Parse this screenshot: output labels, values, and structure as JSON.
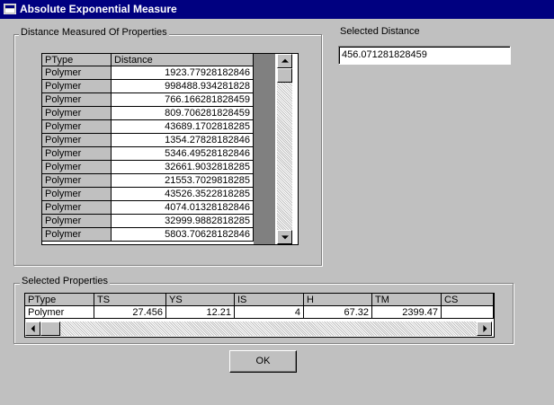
{
  "window": {
    "title": "Absolute Exponential Measure"
  },
  "distance_group": {
    "label": "Distance Measured Of Properties",
    "columns": [
      "PType",
      "Distance"
    ],
    "rows": [
      [
        "Polymer",
        "1923.77928182846"
      ],
      [
        "Polymer",
        "998488.934281828"
      ],
      [
        "Polymer",
        "766.166281828459"
      ],
      [
        "Polymer",
        "809.706281828459"
      ],
      [
        "Polymer",
        "43689.1702818285"
      ],
      [
        "Polymer",
        "1354.27828182846"
      ],
      [
        "Polymer",
        "5346.49528182846"
      ],
      [
        "Polymer",
        "32661.9032818285"
      ],
      [
        "Polymer",
        "21553.7029818285"
      ],
      [
        "Polymer",
        "43526.3522818285"
      ],
      [
        "Polymer",
        "4074.01328182846"
      ],
      [
        "Polymer",
        "32999.9882818285"
      ],
      [
        "Polymer",
        "5803.70628182846"
      ]
    ]
  },
  "selected_distance": {
    "label": "Selected Distance",
    "value": "456.071281828459"
  },
  "properties_group": {
    "label": "Selected Properties",
    "columns": [
      "PType",
      "TS",
      "YS",
      "IS",
      "H",
      "TM",
      "CS"
    ],
    "rows": [
      [
        "Polymer",
        "27.456",
        "12.21",
        "4",
        "67.32",
        "2399.47",
        ""
      ]
    ]
  },
  "ok_button": {
    "label": "OK"
  }
}
